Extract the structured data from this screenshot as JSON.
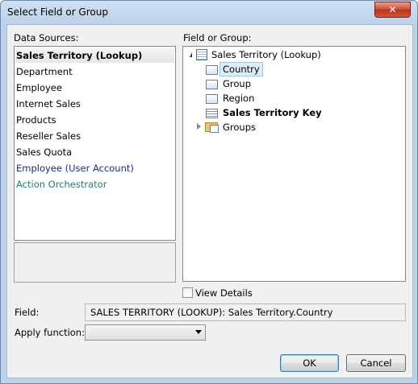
{
  "window": {
    "title": "Select Field or Group",
    "close_label": "✕"
  },
  "data_sources": {
    "label": "Data Sources:",
    "items": [
      {
        "label": "Sales Territory (Lookup)"
      },
      {
        "label": "Department"
      },
      {
        "label": "Employee"
      },
      {
        "label": "Internet Sales"
      },
      {
        "label": "Products"
      },
      {
        "label": "Reseller Sales"
      },
      {
        "label": "Sales Quota"
      },
      {
        "label": "Employee (User Account)"
      },
      {
        "label": "Action Orchestrator"
      }
    ]
  },
  "field_or_group": {
    "label": "Field or Group:",
    "root": "Sales Territory (Lookup)",
    "children": [
      {
        "label": "Country"
      },
      {
        "label": "Group"
      },
      {
        "label": "Region"
      },
      {
        "label": "Sales Territory Key"
      },
      {
        "label": "Groups"
      }
    ]
  },
  "view_details": {
    "label": "View Details",
    "checked": false
  },
  "field": {
    "label": "Field:",
    "value": "SALES TERRITORY (LOOKUP): Sales Territory.Country"
  },
  "apply_function": {
    "label": "Apply function:",
    "value": ""
  },
  "buttons": {
    "ok": "OK",
    "cancel": "Cancel"
  },
  "colors": {
    "title_bar": "#bcd2ea",
    "selection": "#dceefc",
    "user_account_text": "#1a2a8c",
    "orchestrator_text": "#1e7a7a"
  }
}
